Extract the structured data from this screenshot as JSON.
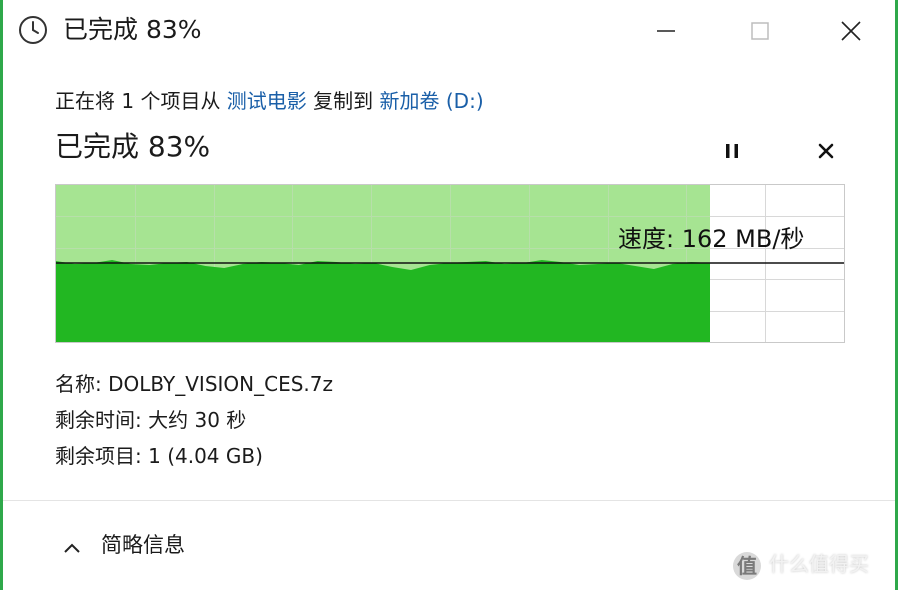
{
  "window": {
    "title": "已完成 83%",
    "controls": {
      "minimize": "minimize",
      "maximize": "maximize",
      "close": "close"
    }
  },
  "copy": {
    "prefix": "正在将 1 个项目从 ",
    "source": "测试电影",
    "middle": " 复制到 ",
    "destination": "新加卷 (D:)"
  },
  "progress": {
    "label": "已完成 83%",
    "percent": 83
  },
  "graph": {
    "speed_text": "速度: 162 MB/秒",
    "colors": {
      "done_fill": "#22b722",
      "done_bg": "#a6e492",
      "grid": "#d8d8d8",
      "speed_line": "#111111"
    }
  },
  "details": {
    "name_label": "名称: ",
    "name_value": "DOLBY_VISION_CES.7z",
    "time_label": "剩余时间: ",
    "time_value": "大约 30 秒",
    "items_label": "剩余项目: ",
    "items_value": "1 (4.04 GB)"
  },
  "footer": {
    "toggle_label": "简略信息"
  },
  "watermark": {
    "logo": "值",
    "text": "什么值得买"
  },
  "icons": {
    "title": "clock-icon",
    "pause": "pause-icon",
    "cancel": "close-icon",
    "toggle": "chevron-up-icon"
  }
}
